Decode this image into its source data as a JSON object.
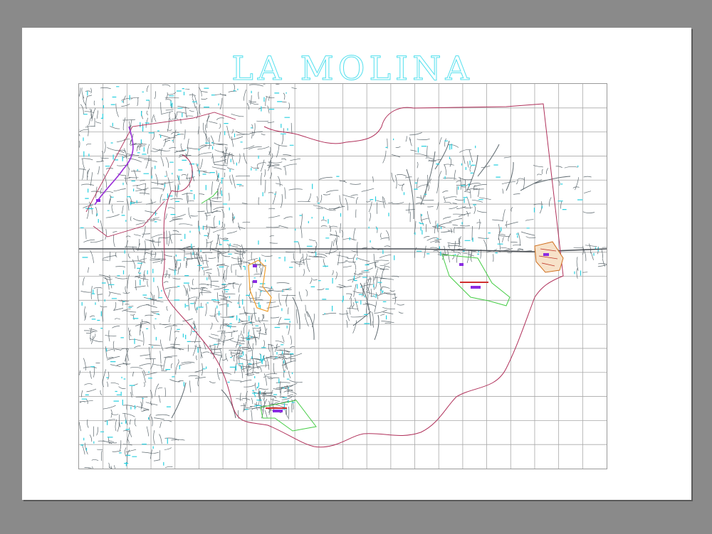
{
  "sheet": {
    "title": "LA MOLINA"
  },
  "map": {
    "grid": {
      "columns": 22,
      "rows": 16
    },
    "colors": {
      "background_canvas": "#8a8a8a",
      "paper": "#ffffff",
      "grid": "#a9a9a9",
      "streets": "#5f6a70",
      "labels": "#2ad0e0",
      "district_boundary": "#b0305a",
      "park_outline": "#44cc44",
      "highlight_orange": "#f0a030",
      "highlight_purple": "#8a2be2"
    }
  }
}
